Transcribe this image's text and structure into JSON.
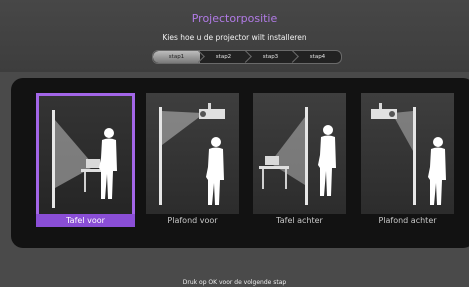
{
  "header": {
    "title": "Projectorpositie",
    "subtitle": "Kies hoe u de projector wilt installeren"
  },
  "steps": [
    {
      "label": "stap1",
      "active": true
    },
    {
      "label": "stap2",
      "active": false
    },
    {
      "label": "stap3",
      "active": false
    },
    {
      "label": "stap4",
      "active": false
    }
  ],
  "options": [
    {
      "label": "Tafel voor",
      "selected": true
    },
    {
      "label": "Plafond voor",
      "selected": false
    },
    {
      "label": "Tafel achter",
      "selected": false
    },
    {
      "label": "Plafond achter",
      "selected": false
    }
  ],
  "footer": {
    "hint": "Druk op OK voor de volgende stap"
  },
  "colors": {
    "accent": "#a366e8",
    "title": "#b17be6"
  }
}
